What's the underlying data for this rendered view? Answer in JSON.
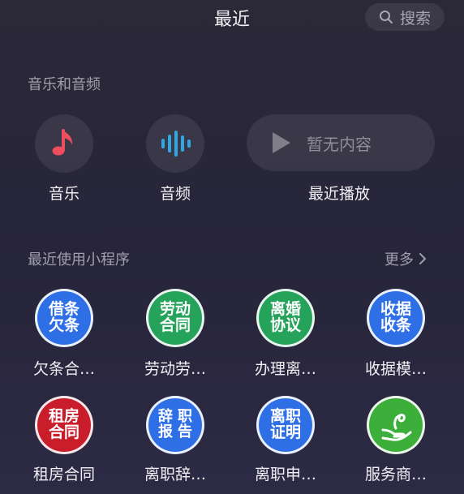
{
  "header": {
    "title": "最近",
    "search_label": "搜索"
  },
  "media_section": {
    "title": "音乐和音频",
    "items": [
      {
        "label": "音乐"
      },
      {
        "label": "音频"
      }
    ],
    "recent": {
      "pill_text": "暂无内容",
      "label": "最近播放"
    }
  },
  "mini_section": {
    "title": "最近使用小程序",
    "more_label": "更多",
    "items": [
      {
        "icon_line1": "借条",
        "icon_line2": "欠条",
        "label": "欠条合…",
        "color": "#2f6fe6"
      },
      {
        "icon_line1": "劳动",
        "icon_line2": "合同",
        "label": "劳动劳…",
        "color": "#25a35a"
      },
      {
        "icon_line1": "离婚",
        "icon_line2": "协议",
        "label": "办理离…",
        "color": "#25a35a"
      },
      {
        "icon_line1": "收据",
        "icon_line2": "收条",
        "label": "收据模…",
        "color": "#2f6fe6"
      },
      {
        "icon_line1": "租房",
        "icon_line2": "合同",
        "label": "租房合同",
        "color": "#c91d2b"
      },
      {
        "icon_line1": "辞职",
        "icon_line2": "报告",
        "label": "离职辞…",
        "color": "#2f6fe6"
      },
      {
        "icon_line1": "离职",
        "icon_line2": "证明",
        "label": "离职申…",
        "color": "#2f6fe6"
      },
      {
        "icon_name": "hand-leaf-icon",
        "label": "服务商…",
        "color": "#3cae3a"
      }
    ]
  }
}
